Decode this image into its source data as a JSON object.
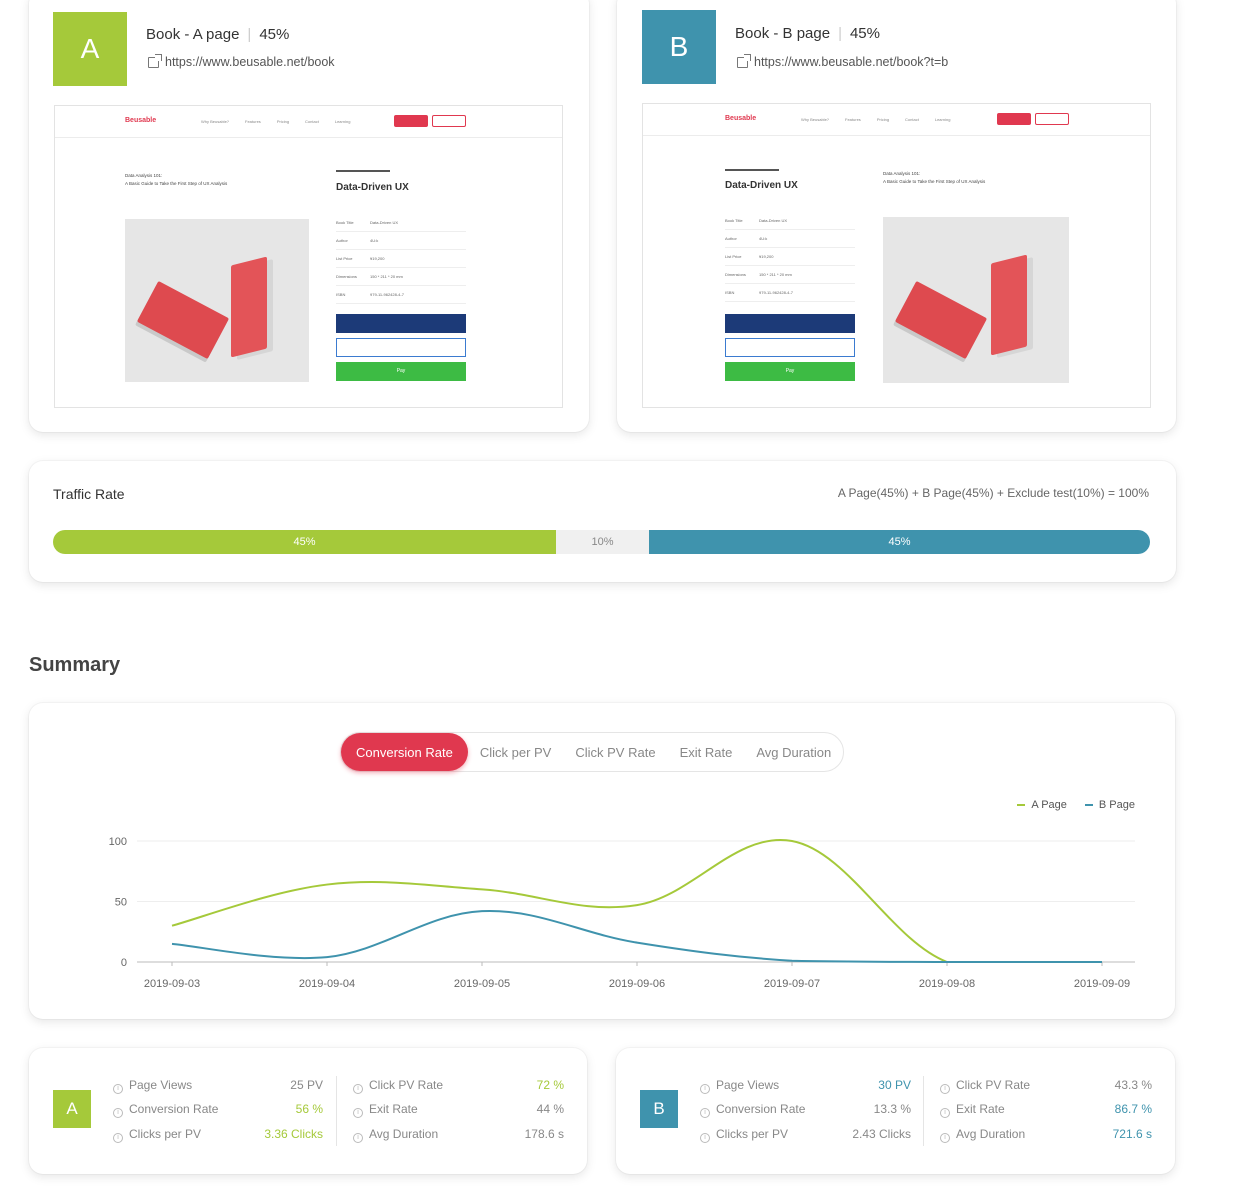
{
  "variants": {
    "a": {
      "badge": "A",
      "name": "Book - A page",
      "traffic": "45%",
      "url": "https://www.beusable.net/book"
    },
    "b": {
      "badge": "B",
      "name": "Book - B page",
      "traffic": "45%",
      "url": "https://www.beusable.net/book?t=b"
    }
  },
  "preview": {
    "logo": "Beusable",
    "menu": [
      "Why Beusable?",
      "Features",
      "Pricing",
      "Contact",
      "Learning"
    ],
    "book_title": "Data-Driven UX",
    "subtitle_1": "Data Analysis 101:",
    "subtitle_2": "A Basic Guide to Take the First Step of UX Analysis",
    "rows": [
      {
        "k": "Book Title",
        "v": "Data-Driven UX"
      },
      {
        "k": "Author",
        "v": "4U:k"
      },
      {
        "k": "List Price",
        "v": "¥19,200"
      },
      {
        "k": "Dimensions",
        "v": "150 * 211 * 20 mm"
      },
      {
        "k": "ISBN",
        "v": "979-11-962428-4-7"
      }
    ],
    "pay_label": "Pay"
  },
  "traffic": {
    "title": "Traffic Rate",
    "formula": "A Page(45%) + B Page(45%) + Exclude test(10%) = 100%",
    "a_label": "45%",
    "exclude_label": "10%",
    "b_label": "45%",
    "a_share": 0.45,
    "exclude_share": 0.1,
    "b_share": 0.45
  },
  "summary": {
    "title": "Summary",
    "tabs": [
      "Conversion Rate",
      "Click per PV",
      "Click PV Rate",
      "Exit Rate",
      "Avg Duration"
    ],
    "active_tab": 0
  },
  "chart_data": {
    "type": "line",
    "x": [
      "2019-09-03",
      "2019-09-04",
      "2019-09-05",
      "2019-09-06",
      "2019-09-07",
      "2019-09-08",
      "2019-09-09"
    ],
    "series": [
      {
        "name": "A Page",
        "color": "#a5c93a",
        "values": [
          30,
          64,
          60,
          47,
          100,
          0,
          0
        ]
      },
      {
        "name": "B Page",
        "color": "#3f93ad",
        "values": [
          15,
          4,
          42,
          16,
          1,
          0,
          0
        ]
      }
    ],
    "yticks": [
      0,
      50,
      100
    ],
    "ylim": [
      0,
      100
    ],
    "legend": "top-right",
    "grid": true
  },
  "stats": {
    "a": {
      "badge": "A",
      "left": [
        {
          "label": "Page Views",
          "value": "25 PV",
          "hl": false
        },
        {
          "label": "Conversion Rate",
          "value": "56 %",
          "hl": true
        },
        {
          "label": "Clicks per PV",
          "value": "3.36 Clicks",
          "hl": true
        }
      ],
      "right": [
        {
          "label": "Click PV Rate",
          "value": "72 %",
          "hl": true
        },
        {
          "label": "Exit Rate",
          "value": "44 %",
          "hl": false
        },
        {
          "label": "Avg Duration",
          "value": "178.6 s",
          "hl": false
        }
      ]
    },
    "b": {
      "badge": "B",
      "left": [
        {
          "label": "Page Views",
          "value": "30 PV",
          "hl": true
        },
        {
          "label": "Conversion Rate",
          "value": "13.3 %",
          "hl": false
        },
        {
          "label": "Clicks per PV",
          "value": "2.43 Clicks",
          "hl": false
        }
      ],
      "right": [
        {
          "label": "Click PV Rate",
          "value": "43.3 %",
          "hl": false
        },
        {
          "label": "Exit Rate",
          "value": "86.7 %",
          "hl": true
        },
        {
          "label": "Avg Duration",
          "value": "721.6 s",
          "hl": true
        }
      ]
    }
  }
}
